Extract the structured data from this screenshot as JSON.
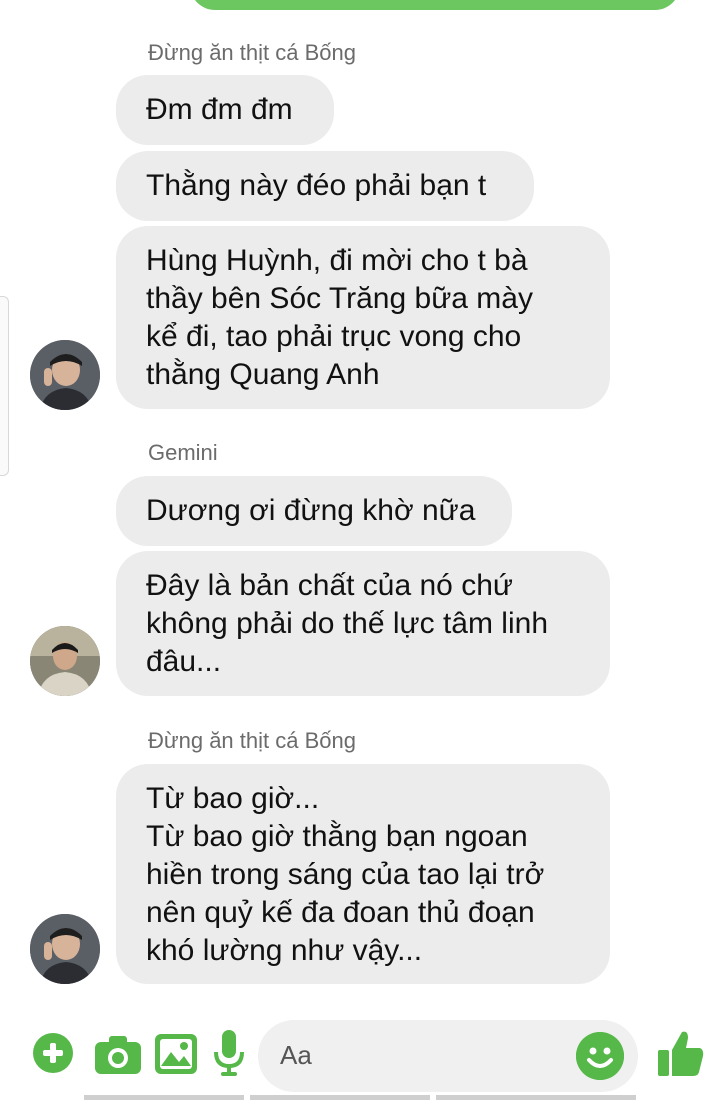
{
  "messages": [
    {
      "sender": "Đừng ăn thịt cá Bống",
      "bubbles": [
        "Đm đm đm",
        "Thằng này đéo phải bạn t",
        "Hùng Huỳnh, đi mời cho t bà\nthầy bên Sóc Trăng bữa mày\nkể đi, tao phải trục vong cho\nthằng Quang Anh"
      ]
    },
    {
      "sender": "Gemini",
      "bubbles": [
        "Dương ơi đừng khờ nữa",
        "Đây là bản chất của nó chứ\nkhông phải do thế lực tâm linh\nđâu..."
      ]
    },
    {
      "sender": "Đừng ăn thịt cá Bống",
      "bubbles": [
        "Từ bao giờ...\nTừ bao giờ thằng bạn ngoan\nhiền trong sáng của tao lại trở\nnên quỷ kế đa đoan thủ đoạn\nkhó lường như vậy..."
      ]
    }
  ],
  "composer": {
    "placeholder": "Aa",
    "icons": [
      "plus-icon",
      "camera-icon",
      "image-icon",
      "microphone-icon",
      "emoji-icon",
      "thumbs-up-icon"
    ]
  },
  "colors": {
    "accent": "#55b848",
    "bubble": "#ececec",
    "sent_bubble": "#6cc760"
  }
}
